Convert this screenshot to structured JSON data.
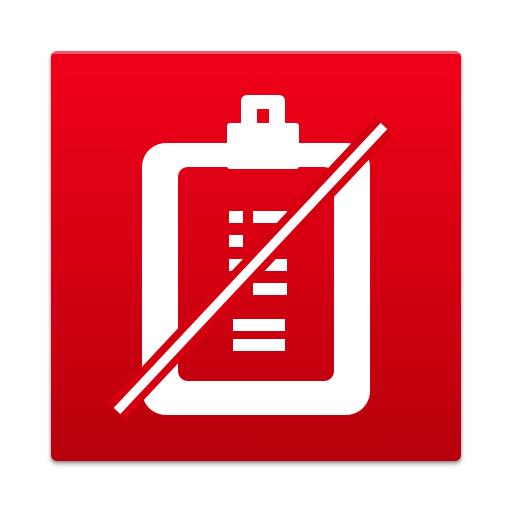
{
  "icon": {
    "name": "clipboard-crossed-out-icon",
    "background_color_top": "#f0001a",
    "background_color_bottom": "#b8000c",
    "glyph_color": "#ffffff"
  }
}
